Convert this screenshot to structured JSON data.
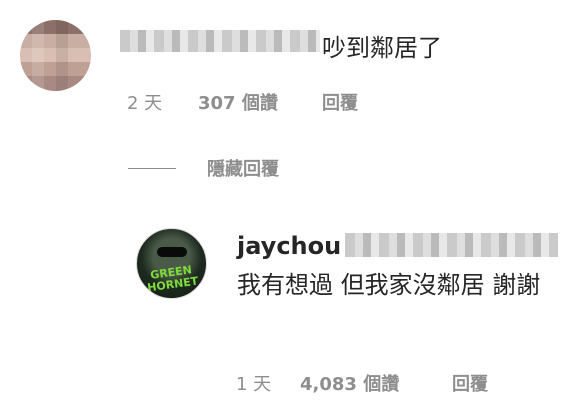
{
  "comment": {
    "text": "吵到鄰居了",
    "time": "2 天",
    "likes": "307 個讚",
    "reply": "回覆"
  },
  "replies_toggle": {
    "label": "隱藏回覆"
  },
  "reply": {
    "username": "jaychou",
    "avatar_text": "GREEN HORNET",
    "text": "我有想過 但我家沒鄰居 謝謝",
    "time": "1 天",
    "likes": "4,083 個讚",
    "reply": "回覆"
  }
}
